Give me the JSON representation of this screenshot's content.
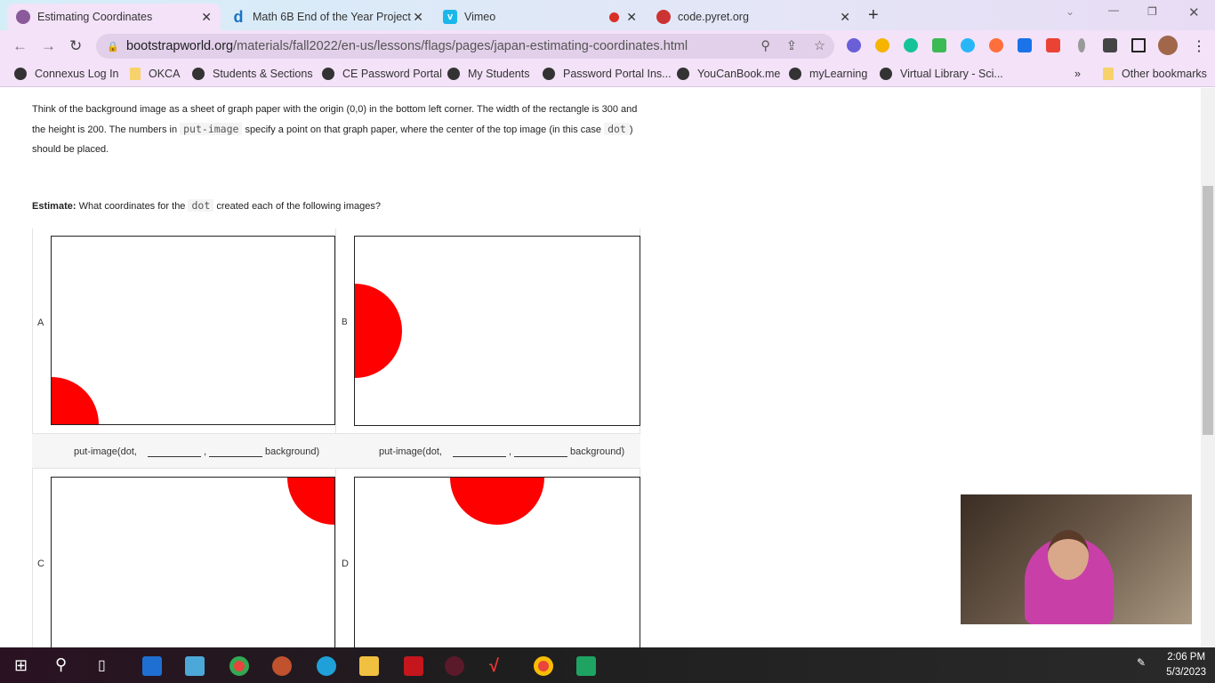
{
  "browser": {
    "tabs": [
      {
        "title": "Estimating Coordinates",
        "active": true
      },
      {
        "title": "Math 6B End of the Year Project",
        "active": false
      },
      {
        "title": "Vimeo",
        "active": false
      },
      {
        "title": "code.pyret.org",
        "active": false
      }
    ],
    "url_domain": "bootstrapworld.org",
    "url_path": "/materials/fall2022/en-us/lessons/flags/pages/japan-estimating-coordinates.html",
    "bookmarks": [
      "Connexus Log In",
      "OKCA",
      "Students & Sections",
      "CE Password Portal",
      "My Students",
      "Password Portal Ins...",
      "YouCanBook.me",
      "myLearning",
      "Virtual Library - Sci..."
    ],
    "other_bookmarks": "Other bookmarks",
    "overflow": "»"
  },
  "page": {
    "intro_1": "Think of the background image as a sheet of graph paper with the origin (0,0) in the bottom left corner. The width of the rectangle is 300 and the height is 200. The numbers in ",
    "intro_code1": "put-image",
    "intro_2": " specify a point on that graph paper, where the center of the top image (in this case ",
    "intro_code2": "dot",
    "intro_3": ") should be placed.",
    "estimate_bold": "Estimate:",
    "estimate_1": " What coordinates for the ",
    "estimate_code": "dot",
    "estimate_2": " created each of the following images?",
    "put_prefix": "put-image(dot,",
    "put_comma": ",",
    "put_suffix": "background)",
    "images": [
      {
        "label": "A"
      },
      {
        "label": "B"
      },
      {
        "label": "C"
      },
      {
        "label": "D"
      }
    ],
    "dot_color": "#ff0000"
  },
  "taskbar": {
    "time": "2:06 PM",
    "date": "5/3/2023"
  }
}
